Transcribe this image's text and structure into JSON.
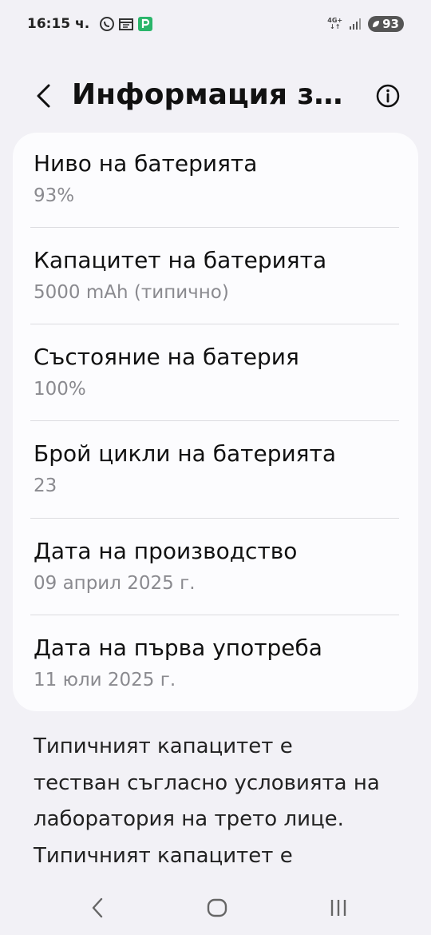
{
  "status_bar": {
    "time": "16:15 ч.",
    "network_label_top": "4G+",
    "network_label_bottom": "↓↑",
    "battery_level": "93",
    "icons": [
      "viber-icon",
      "calendar-icon",
      "parking-app-icon",
      "signal-icon",
      "battery-leaf-icon"
    ]
  },
  "header": {
    "title": "Информация за батерията",
    "back_icon": "chevron-left-icon",
    "info_icon": "info-circle-icon"
  },
  "battery_info": {
    "items": [
      {
        "label": "Ниво на батерията",
        "value": "93%"
      },
      {
        "label": "Капацитет на батерията",
        "value": "5000 mAh (типично)"
      },
      {
        "label": "Състояние на батерия",
        "value": "100%"
      },
      {
        "label": "Брой цикли на батерията",
        "value": "23"
      },
      {
        "label": "Дата на производство",
        "value": "09 април 2025 г."
      },
      {
        "label": "Дата на първа употреба",
        "value": "11 юли 2025 г."
      }
    ]
  },
  "footnote": {
    "text": "Типичният капацитет е тестван съгласно условията на лаборатория на трето лице. Типичният капацитет е"
  },
  "nav_bar": {
    "icons": [
      "back-icon",
      "home-icon",
      "recents-icon"
    ]
  },
  "colors": {
    "background": "#f2f1f6",
    "card": "#fcfcfe",
    "secondary_text": "#8a8a8f"
  }
}
